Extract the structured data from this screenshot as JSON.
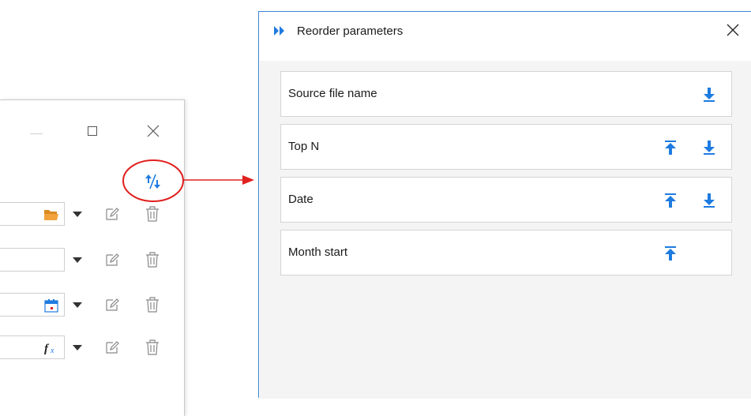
{
  "dialog": {
    "title": "Reorder parameters",
    "close_glyph": "✕",
    "app_icon": "chevrons-right-icon",
    "items": [
      {
        "label": "Source file name",
        "move_up": false,
        "move_down": true
      },
      {
        "label": "Top N",
        "move_up": true,
        "move_down": true
      },
      {
        "label": "Date",
        "move_up": true,
        "move_down": true
      },
      {
        "label": "Month start",
        "move_up": true,
        "move_down": false
      }
    ]
  },
  "background_window": {
    "controls": [
      "minimize-icon",
      "maximize-icon",
      "close-icon"
    ],
    "reorder_button_icon": "reorder-params-icon",
    "parameter_rows": [
      {
        "field_icon": "folder-icon"
      },
      {
        "field_icon": ""
      },
      {
        "field_icon": "calendar-icon"
      },
      {
        "field_icon": "function-fx-icon",
        "field_icon_text": "fx"
      }
    ]
  },
  "colors": {
    "accent_blue": "#1e7be0",
    "annotation_red": "#e0201e",
    "folder_orange": "#f2a23a",
    "dialog_border": "#3c86d6"
  }
}
